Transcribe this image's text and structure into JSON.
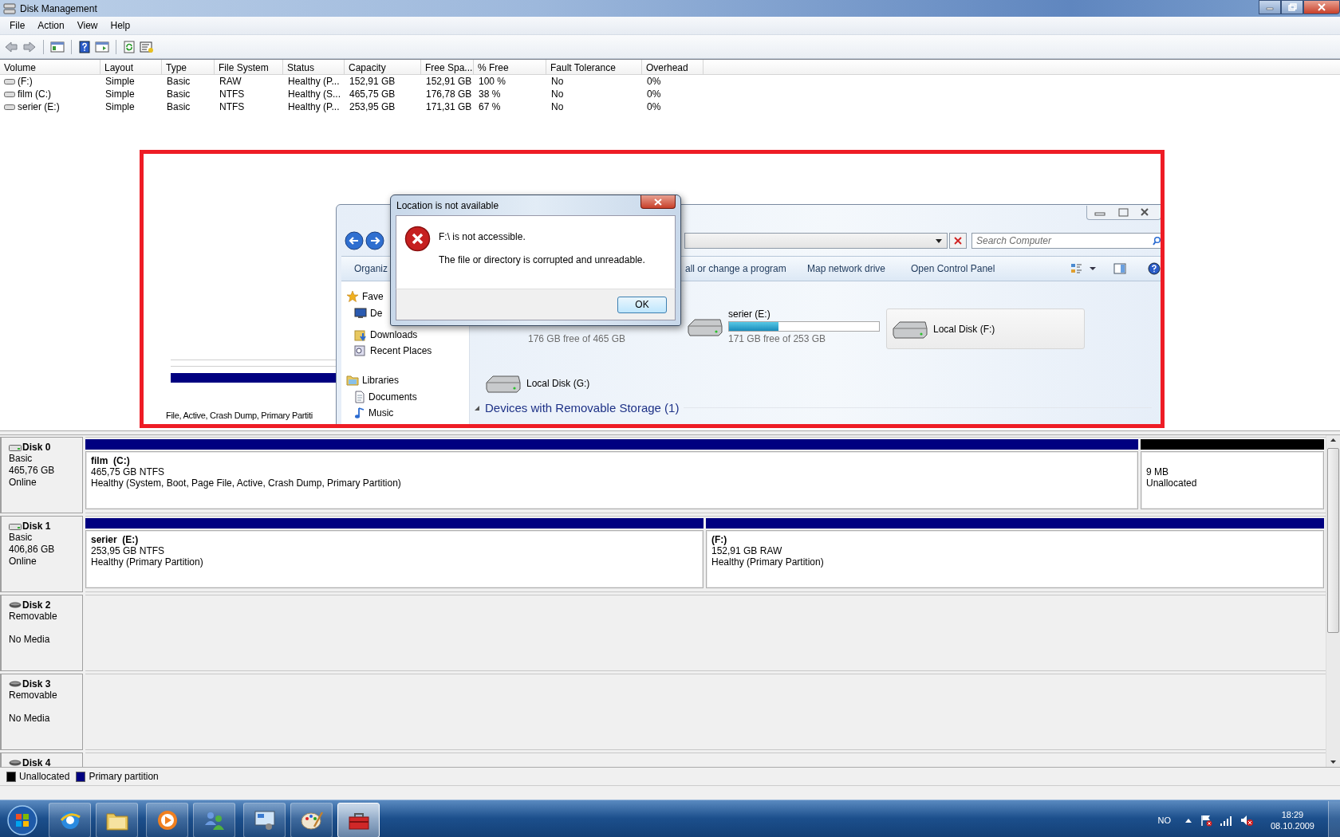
{
  "window": {
    "title": "Disk Management"
  },
  "menu": [
    {
      "label": "File"
    },
    {
      "label": "Action"
    },
    {
      "label": "View"
    },
    {
      "label": "Help"
    }
  ],
  "volumes": {
    "columns": [
      "Volume",
      "Layout",
      "Type",
      "File System",
      "Status",
      "Capacity",
      "Free Spa...",
      "% Free",
      "Fault Tolerance",
      "Overhead"
    ],
    "rows": [
      [
        "(F:)",
        "Simple",
        "Basic",
        "RAW",
        "Healthy (P...",
        "152,91 GB",
        "152,91 GB",
        "100 %",
        "No",
        "0%"
      ],
      [
        "film (C:)",
        "Simple",
        "Basic",
        "NTFS",
        "Healthy (S...",
        "465,75 GB",
        "176,78 GB",
        "38 %",
        "No",
        "0%"
      ],
      [
        "serier (E:)",
        "Simple",
        "Basic",
        "NTFS",
        "Healthy (P...",
        "253,95 GB",
        "171,31 GB",
        "67 %",
        "No",
        "0%"
      ]
    ]
  },
  "embedded_screenshot": {
    "fragment_text": "File, Active, Crash Dump, Primary Partiti",
    "explorer": {
      "search": {
        "placeholder": "Search Computer"
      },
      "commands": [
        "Organiz",
        "all or change a program",
        "Map network drive",
        "Open Control Panel"
      ],
      "nav": [
        {
          "label": "Fave",
          "kind": "favorites"
        },
        {
          "label": "De",
          "kind": "desktop"
        },
        {
          "label": "Downloads",
          "kind": "downloads"
        },
        {
          "label": "Recent Places",
          "kind": "recent"
        },
        {
          "label": "Libraries",
          "kind": "libraries"
        },
        {
          "label": "Documents",
          "kind": "documents"
        },
        {
          "label": "Music",
          "kind": "music"
        }
      ],
      "drives": [
        {
          "kind": "partial",
          "free": "176 GB free of 465 GB",
          "selected": false
        },
        {
          "kind": "bar",
          "name": "serier (E:)",
          "level": 0.33,
          "free": "171 GB free of 253 GB",
          "selected": false
        },
        {
          "kind": "tile",
          "name": "Local Disk (F:)",
          "selected": true
        },
        {
          "kind": "tile",
          "name": "Local Disk (G:)",
          "selected": false
        }
      ],
      "section": "Devices with Removable Storage (1)"
    },
    "dialog": {
      "title": "Location is not available",
      "message": "F:\\ is not accessible.",
      "detail": "The file or directory is corrupted and unreadable.",
      "button": "OK"
    }
  },
  "disks": [
    {
      "name": "Disk 0",
      "kind": "fixed",
      "info": [
        "Basic",
        "465,76 GB",
        "Online"
      ],
      "partitions": [
        {
          "kind": "primary",
          "name": "film  (C:)",
          "lines": [
            "465,75 GB NTFS",
            "Healthy (System, Boot, Page File, Active, Crash Dump, Primary Partition)"
          ]
        },
        {
          "kind": "unallocated",
          "lines": [
            "9 MB",
            "Unallocated"
          ]
        }
      ]
    },
    {
      "name": "Disk 1",
      "kind": "fixed",
      "info": [
        "Basic",
        "406,86 GB",
        "Online"
      ],
      "partitions": [
        {
          "kind": "primary",
          "name": "serier  (E:)",
          "lines": [
            "253,95 GB NTFS",
            "Healthy (Primary Partition)"
          ]
        },
        {
          "kind": "primary",
          "name": "(F:)",
          "lines": [
            "152,91 GB RAW",
            "Healthy (Primary Partition)"
          ]
        }
      ]
    },
    {
      "name": "Disk 2",
      "kind": "removable",
      "info": [
        "Removable"
      ],
      "status": "No Media"
    },
    {
      "name": "Disk 3",
      "kind": "removable",
      "info": [
        "Removable"
      ],
      "status": "No Media"
    },
    {
      "name": "Disk 4",
      "kind": "removable"
    }
  ],
  "legend": [
    {
      "label": "Unallocated",
      "color": "#000000"
    },
    {
      "label": "Primary partition",
      "color": "#000080"
    }
  ],
  "taskbar": {
    "apps": [
      {
        "kind": "browser",
        "selected": false
      },
      {
        "kind": "folder",
        "selected": false
      },
      {
        "kind": "media",
        "selected": false
      },
      {
        "kind": "people",
        "selected": false
      },
      {
        "kind": "remote",
        "selected": false
      },
      {
        "kind": "paint",
        "selected": false
      },
      {
        "kind": "toolbox",
        "selected": true
      }
    ],
    "language": "NO",
    "time": "18:29",
    "date": "08.10.2009"
  }
}
